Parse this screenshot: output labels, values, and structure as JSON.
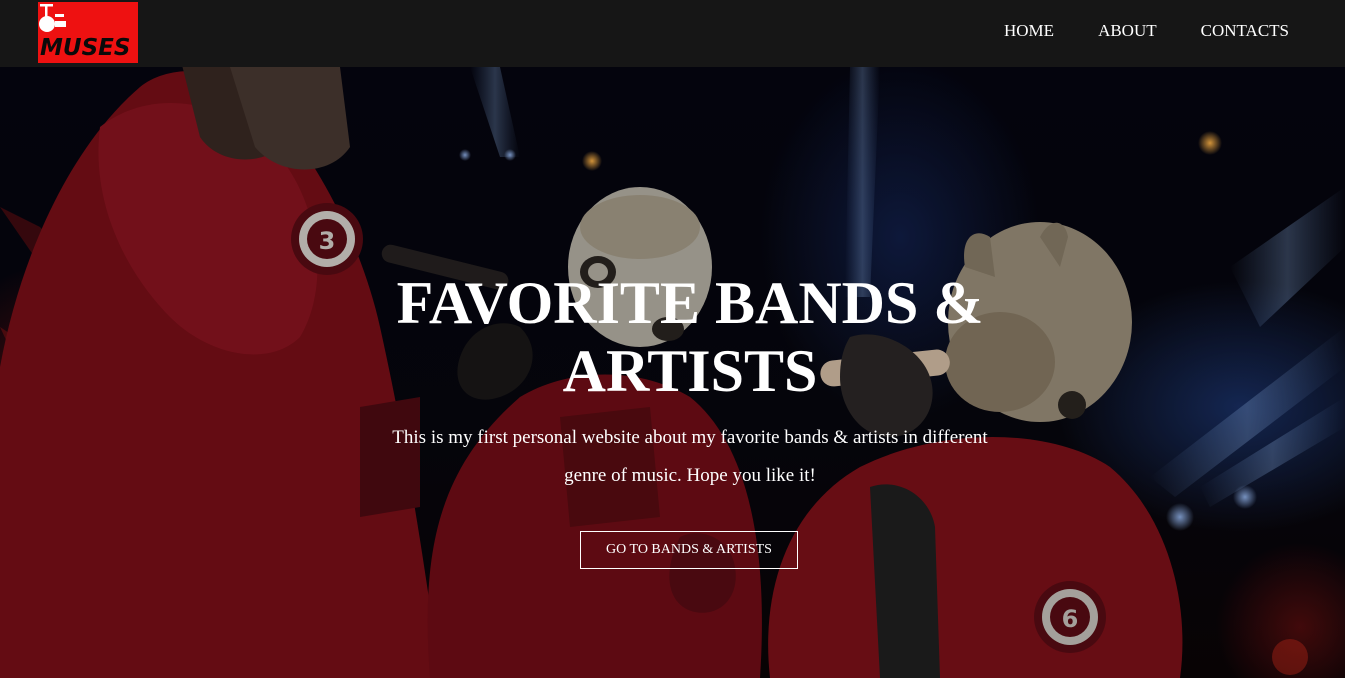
{
  "brand": {
    "logo_text": "MUSES",
    "logo_color": "#ee1111"
  },
  "nav": {
    "items": [
      {
        "label": "HOME"
      },
      {
        "label": "ABOUT"
      },
      {
        "label": "CONTACTS"
      }
    ]
  },
  "hero": {
    "title": "FAVORITE BANDS & ARTISTS",
    "subtitle": "This is my first personal website about my favorite bands & artists in different genre of music. Hope you like it!",
    "button_label": "GO TO BANDS & ARTISTS"
  },
  "colors": {
    "navbar_bg": "#161616",
    "text": "#ffffff",
    "accent_red": "#ee1111"
  }
}
